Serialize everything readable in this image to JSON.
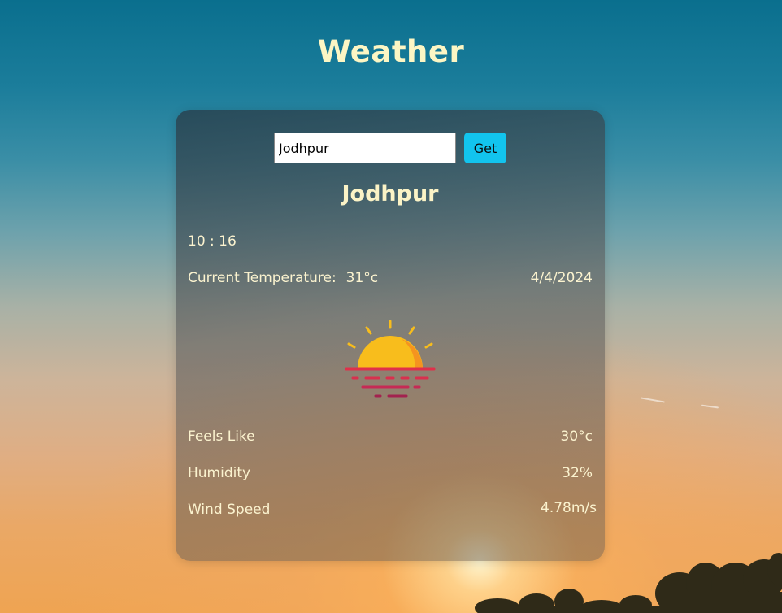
{
  "page": {
    "title": "Weather"
  },
  "search": {
    "value": "Jodhpur",
    "button_label": "Get"
  },
  "weather": {
    "city": "Jodhpur",
    "time": "10 : 16",
    "current_temp_label": "Current Temperature:",
    "current_temp_value": "31°c",
    "date": "4/4/2024",
    "icon": "sunset-icon",
    "feels_like_label": "Feels Like",
    "feels_like_value": "30°c",
    "humidity_label": "Humidity",
    "humidity_value": "32%",
    "wind_label": "Wind Speed",
    "wind_value": "4.78m/s"
  },
  "colors": {
    "title": "#fcf6c4",
    "button": "#12c4ee",
    "sun": "#f8bd1c",
    "sun_shade": "#f5941f",
    "water_lines": "#e0304a"
  }
}
